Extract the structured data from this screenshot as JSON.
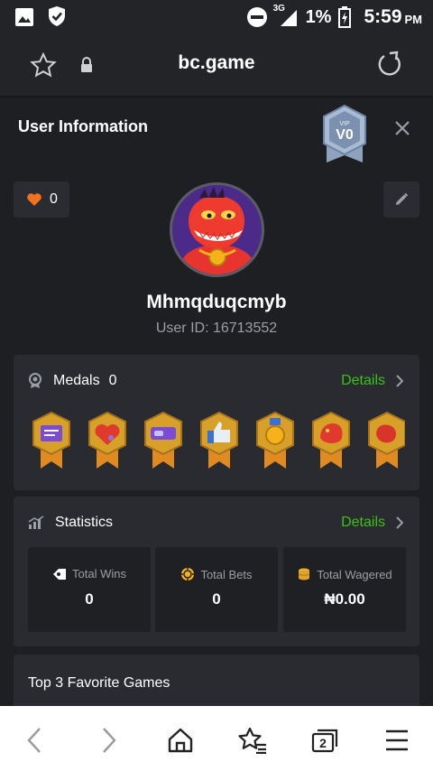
{
  "status_bar": {
    "battery": "1%",
    "network": "3G",
    "time": "5:59",
    "ampm": "PM"
  },
  "browser": {
    "url": "bc.game",
    "tab_count": "2"
  },
  "modal": {
    "title": "User Information",
    "vip_label": "VIP",
    "vip_level": "V0",
    "likes": "0",
    "username": "Mhmqduqcmyb",
    "user_id": "User ID: 16713552"
  },
  "medals": {
    "title": "Medals",
    "count": "0",
    "details": "Details"
  },
  "statistics": {
    "title": "Statistics",
    "details": "Details",
    "items": [
      {
        "label": "Total Wins",
        "value": "0"
      },
      {
        "label": "Total Bets",
        "value": "0"
      },
      {
        "label": "Total Wagered",
        "value": "₦0.00"
      }
    ]
  },
  "favorites": {
    "title": "Top 3 Favorite Games"
  },
  "colors": {
    "accent_green": "#3bc117",
    "heart_orange": "#f2711c",
    "gold": "#e0a32a"
  }
}
